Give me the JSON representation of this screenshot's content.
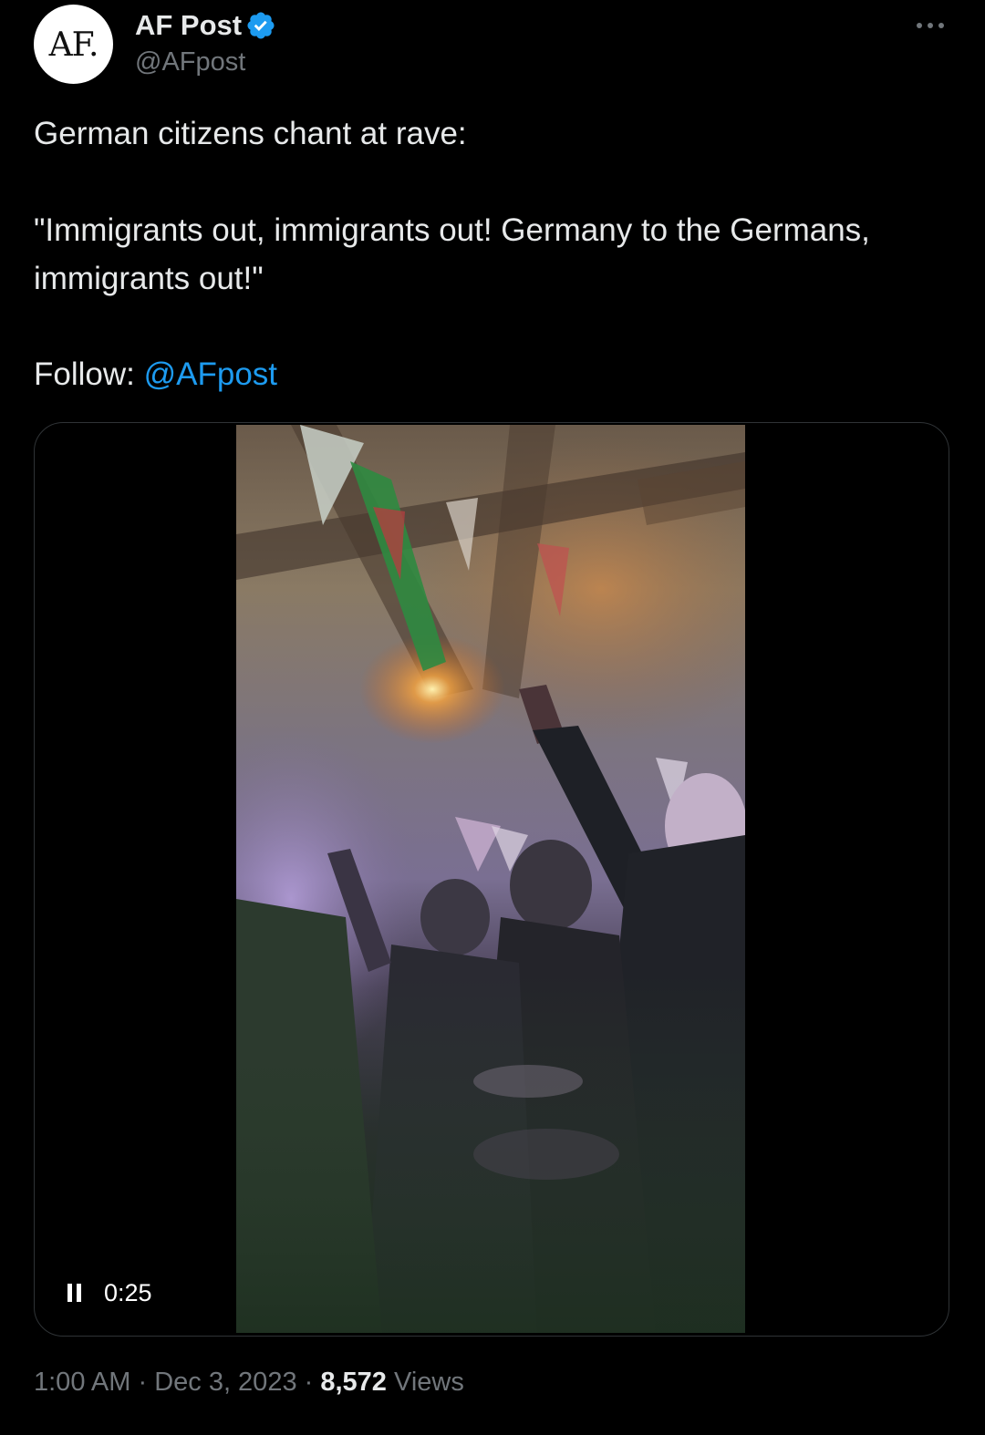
{
  "author": {
    "avatar_text": "AF.",
    "display_name": "AF Post",
    "handle": "@AFpost",
    "verified_color": "#1d9bf0"
  },
  "tweet": {
    "line1": "German citizens chant at rave:",
    "line2": "\"Immigrants out, immigrants out! Germany to the Germans, immigrants out!\"",
    "follow_prefix": "Follow: ",
    "follow_mention": "@AFpost"
  },
  "media": {
    "type": "video",
    "time": "0:25",
    "state_icon": "pause-icon"
  },
  "meta": {
    "time": "1:00 AM",
    "sep1": " · ",
    "date": "Dec 3, 2023",
    "sep2": " · ",
    "views_count": "8,572",
    "views_label": " Views"
  },
  "colors": {
    "background": "#000000",
    "text": "#e7e9ea",
    "secondary": "#71767b",
    "link": "#1d9bf0",
    "border": "#2f3336"
  }
}
